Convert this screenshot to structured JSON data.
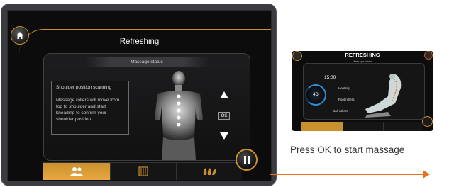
{
  "screen": {
    "title": "Refreshing",
    "status_label": "Massage status",
    "info": {
      "title": "Shoulder position scanning",
      "body": "Massage rollers will move from top to shoulder and start kneading to confirm your shoulder position."
    },
    "controls": {
      "ok_label": "OK"
    },
    "nav_tabs": [
      "users-icon",
      "program-grid-icon",
      "feet-icon"
    ],
    "accent_color": "#c9902e"
  },
  "preview": {
    "title": "REFRESHING",
    "subtitle": "Massage status",
    "time": "15:00",
    "mode": "4D",
    "options": [
      "Heating",
      "Foot rollers",
      "Calf rollers"
    ]
  },
  "caption": "Press OK to start massage",
  "colors": {
    "arrow": "#e8731e",
    "accent": "#c9902e",
    "ring": "#2f8fd6"
  }
}
